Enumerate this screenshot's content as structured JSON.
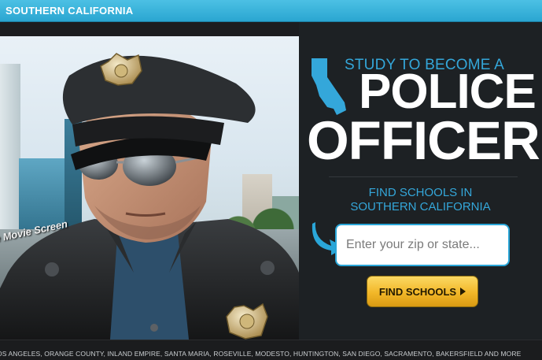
{
  "header": {
    "region": "SOUTHERN CALIFORNIA"
  },
  "hero": {
    "tagline": "e Movie Screen",
    "study": "STUDY TO BECOME A",
    "title_line1": "POLICE",
    "title_line2": "OFFICER",
    "find_line1": "FIND SCHOOLS IN",
    "find_line2": "SOUTHERN CALIFORNIA",
    "zip_placeholder": "Enter your zip or state...",
    "find_button": "FIND SCHOOLS"
  },
  "footer": {
    "cities": "OS ANGELES, ORANGE COUNTY, INLAND EMPIRE, SANTA MARIA, ROSEVILLE, MODESTO, HUNTINGTON, SAN DIEGO, SACRAMENTO, BAKERSFIELD AND MORE"
  },
  "colors": {
    "accent": "#34a7da",
    "header_bar": "#2aa6d1",
    "button_gold": "#f2b728",
    "panel_bg": "#1d2124"
  },
  "icons": {
    "state": "california-state-icon",
    "arrow": "curved-arrow-icon",
    "button": "play-triangle-icon"
  }
}
